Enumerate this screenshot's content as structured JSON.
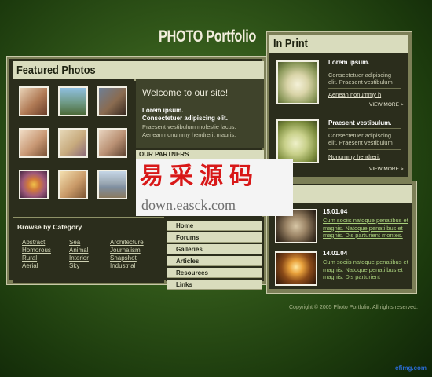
{
  "header": {
    "title": "PHOTO Portfolio"
  },
  "featured": {
    "title": "Featured Photos",
    "thumbnails": [
      {
        "name": "woman-portrait",
        "color": "#b07a55"
      },
      {
        "name": "landscape-tree",
        "color": "#6f9a86"
      },
      {
        "name": "group-photo",
        "color": "#8a6b50"
      },
      {
        "name": "reclining-woman",
        "color": "#c89874"
      },
      {
        "name": "woman-beach",
        "color": "#c7aa7d"
      },
      {
        "name": "woman-sitting",
        "color": "#b99073"
      },
      {
        "name": "flower-macro",
        "color": "#a05a7a"
      },
      {
        "name": "blonde-woman",
        "color": "#c99a68"
      },
      {
        "name": "buildings",
        "color": "#7f8fa0"
      }
    ]
  },
  "welcome": {
    "title": "Welcome to our site!",
    "lead_1": "Lorem ipsum.",
    "lead_2": "Consectetuer adipiscing elit.",
    "body_1": "Praesent vestibulum molestie lacus.",
    "body_2": "Aenean nonummy hendrerit mauris."
  },
  "partners": {
    "title": "OUR PARTNERS"
  },
  "browse": {
    "title": "Browse by Category",
    "categories": [
      "Abstract",
      "Sea",
      "Architecture",
      "Homorous",
      "Animal",
      "Journalism",
      "Rural",
      "Interior",
      "Snapshot",
      "Aerial",
      "Sky",
      "Industrial"
    ]
  },
  "nav": {
    "items": [
      "Home",
      "Forums",
      "Galleries",
      "Articles",
      "Resources",
      "Links"
    ]
  },
  "in_print": {
    "title": "In Print",
    "items": [
      {
        "heading": "Lorem ipsum.",
        "line_1": "Consectetuer adipiscing",
        "line_2": "elit. Praesent vestibulum",
        "link": "Aenean nonummy h",
        "more": "VIEW MORE >"
      },
      {
        "heading": "Praesent vestibulum.",
        "line_1": "Consectetuer adipiscing",
        "line_2": "elit. Praesent vestibulum",
        "link": "Nonummy hendrerit",
        "more": "VIEW MORE >"
      }
    ]
  },
  "news": {
    "title": "s",
    "items": [
      {
        "date": "15.01.04",
        "lines": [
          "Cum sociis natoque penatibus et",
          "magnis. Natoque penati bus et",
          "magnis. Dis parturient montes."
        ]
      },
      {
        "date": "14.01.04",
        "lines": [
          "Cum sociis natoque penatibus et",
          "magnis. Natoque penati bus et",
          "magnis. Dis parturient"
        ]
      }
    ]
  },
  "footer": {
    "copyright": "Copyright © 2005 Photo Portfolio. All rights reserved."
  },
  "watermark": {
    "cn": "易采源码",
    "url": "down.easck.com",
    "footer_mark": "cfimg.com"
  },
  "colors": {
    "accent_light": "#d9dcbd",
    "panel_dark": "#2b2d1c",
    "link_green": "#a9d07c",
    "watermark_red": "#d81818"
  }
}
